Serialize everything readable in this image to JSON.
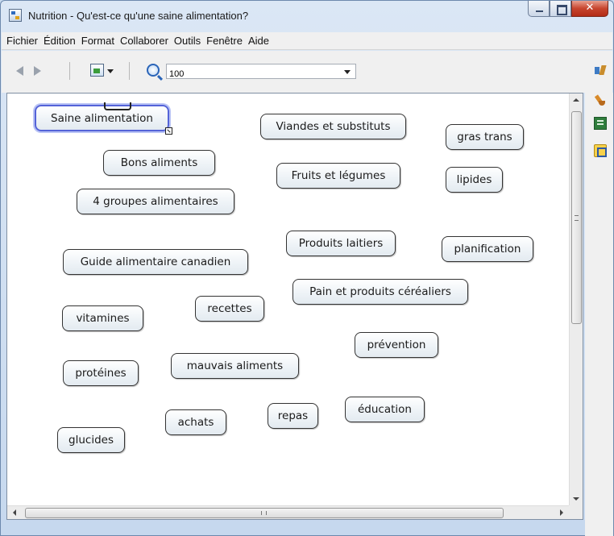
{
  "window": {
    "title": "Nutrition - Qu'est-ce qu'une saine alimentation?"
  },
  "menu": [
    "Fichier",
    "Édition",
    "Format",
    "Collaborer",
    "Outils",
    "Fenêtre",
    "Aide"
  ],
  "toolbar": {
    "zoom_value": "100"
  },
  "nodes": [
    {
      "label": "Saine alimentation"
    },
    {
      "label": "Viandes et substituts"
    },
    {
      "label": "gras trans"
    },
    {
      "label": "Bons  aliments"
    },
    {
      "label": "Fruits et légumes"
    },
    {
      "label": "lipides"
    },
    {
      "label": "4 groupes alimentaires"
    },
    {
      "label": "Produits laitiers"
    },
    {
      "label": "planification"
    },
    {
      "label": "Guide alimentaire canadien"
    },
    {
      "label": "Pain et produits céréaliers"
    },
    {
      "label": "vitamines"
    },
    {
      "label": "recettes"
    },
    {
      "label": "prévention"
    },
    {
      "label": "protéines"
    },
    {
      "label": "mauvais aliments"
    },
    {
      "label": "achats"
    },
    {
      "label": "repas"
    },
    {
      "label": "éducation"
    },
    {
      "label": "glucides"
    }
  ],
  "colors": {
    "selection_border": "#5463d8",
    "node_fill": "#eef3f7",
    "close_button": "#c7452e"
  }
}
